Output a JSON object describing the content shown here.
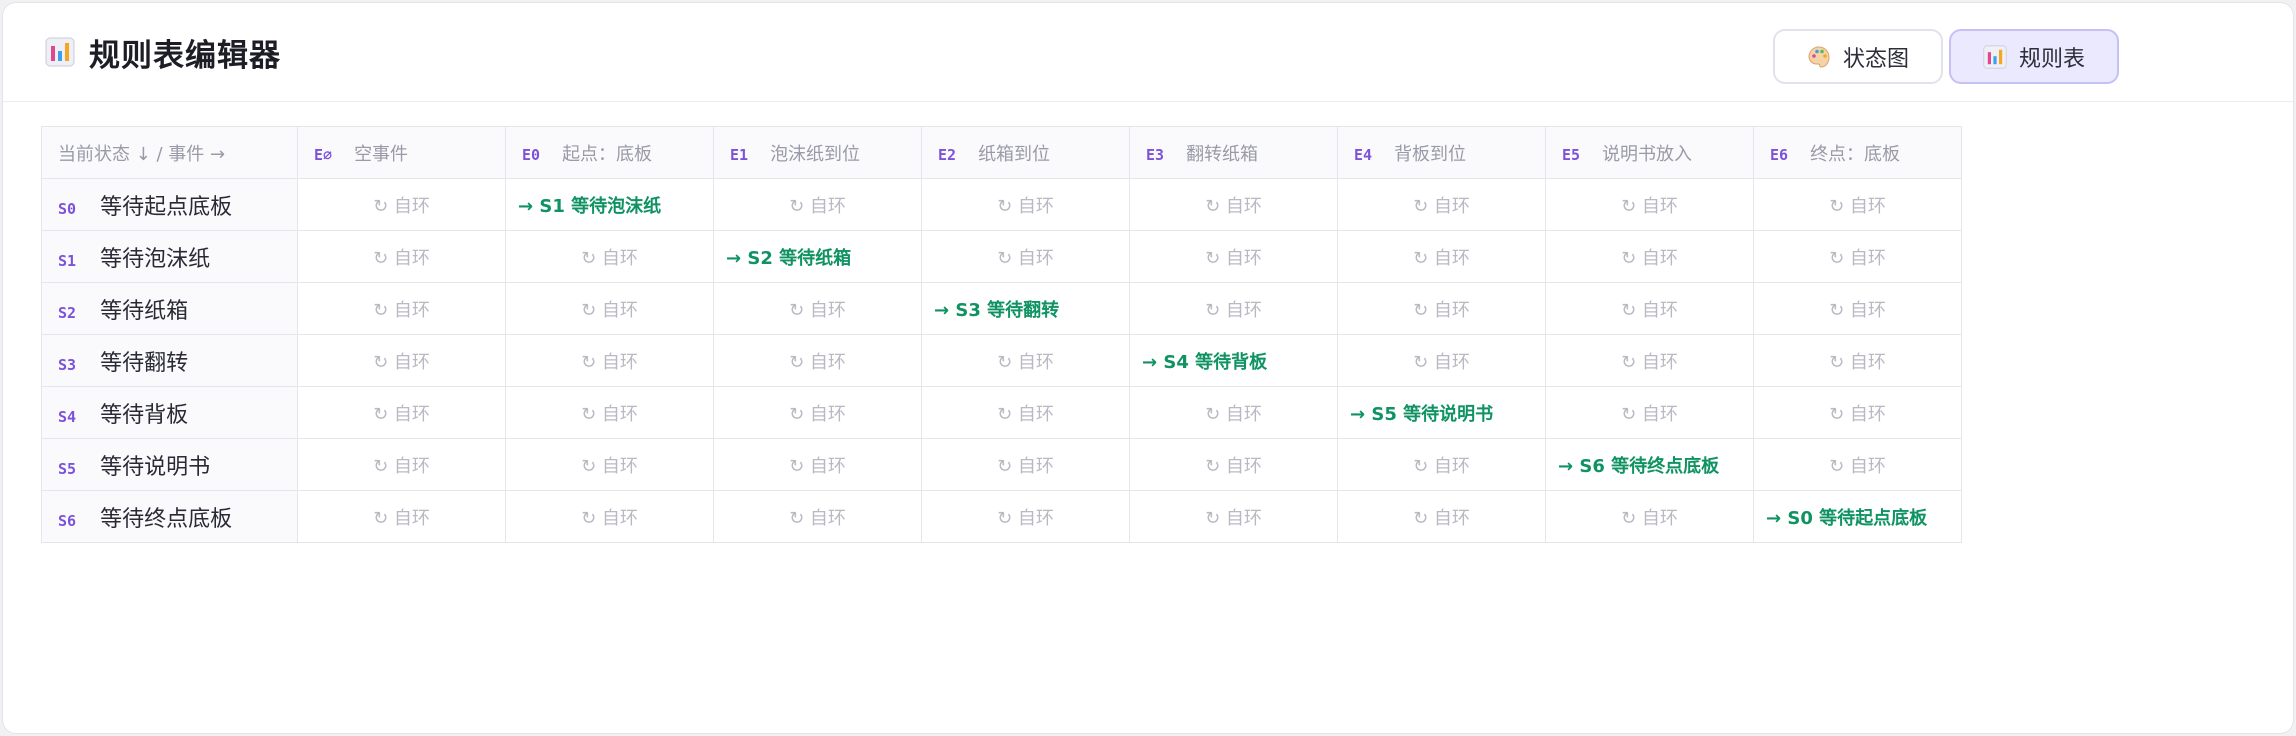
{
  "header": {
    "title": "规则表编辑器",
    "title_icon": "bar-chart-icon",
    "buttons": {
      "state_diagram": {
        "label": "状态图",
        "icon": "palette-icon"
      },
      "rule_table": {
        "label": "规则表",
        "icon": "bar-chart-icon"
      }
    }
  },
  "table": {
    "corner": "当前状态 ↓ / 事件 →",
    "events": [
      {
        "code": "E∅",
        "name": "空事件"
      },
      {
        "code": "E0",
        "name": "起点：底板"
      },
      {
        "code": "E1",
        "name": "泡沫纸到位"
      },
      {
        "code": "E2",
        "name": "纸箱到位"
      },
      {
        "code": "E3",
        "name": "翻转纸箱"
      },
      {
        "code": "E4",
        "name": "背板到位"
      },
      {
        "code": "E5",
        "name": "说明书放入"
      },
      {
        "code": "E6",
        "name": "终点：底板"
      }
    ],
    "rows": [
      {
        "code": "S0",
        "name": "等待起点底板",
        "cells": [
          "↻ 自环",
          "→ S1 等待泡沫纸",
          "↻ 自环",
          "↻ 自环",
          "↻ 自环",
          "↻ 自环",
          "↻ 自环",
          "↻ 自环"
        ]
      },
      {
        "code": "S1",
        "name": "等待泡沫纸",
        "cells": [
          "↻ 自环",
          "↻ 自环",
          "→ S2 等待纸箱",
          "↻ 自环",
          "↻ 自环",
          "↻ 自环",
          "↻ 自环",
          "↻ 自环"
        ]
      },
      {
        "code": "S2",
        "name": "等待纸箱",
        "cells": [
          "↻ 自环",
          "↻ 自环",
          "↻ 自环",
          "→ S3 等待翻转",
          "↻ 自环",
          "↻ 自环",
          "↻ 自环",
          "↻ 自环"
        ]
      },
      {
        "code": "S3",
        "name": "等待翻转",
        "cells": [
          "↻ 自环",
          "↻ 自环",
          "↻ 自环",
          "↻ 自环",
          "→ S4 等待背板",
          "↻ 自环",
          "↻ 自环",
          "↻ 自环"
        ]
      },
      {
        "code": "S4",
        "name": "等待背板",
        "cells": [
          "↻ 自环",
          "↻ 自环",
          "↻ 自环",
          "↻ 自环",
          "↻ 自环",
          "→ S5 等待说明书",
          "↻ 自环",
          "↻ 自环"
        ]
      },
      {
        "code": "S5",
        "name": "等待说明书",
        "cells": [
          "↻ 自环",
          "↻ 自环",
          "↻ 自环",
          "↻ 自环",
          "↻ 自环",
          "↻ 自环",
          "→ S6 等待终点底板",
          "↻ 自环"
        ]
      },
      {
        "code": "S6",
        "name": "等待终点底板",
        "cells": [
          "↻ 自环",
          "↻ 自环",
          "↻ 自环",
          "↻ 自环",
          "↻ 自环",
          "↻ 自环",
          "↻ 自环",
          "→ S0 等待起点底板"
        ]
      }
    ]
  },
  "colors": {
    "accent": "#7b52d9",
    "transition": "#0f9362",
    "self_loop": "#b9b9c4",
    "active_button_bg": "#ebe9fd"
  }
}
